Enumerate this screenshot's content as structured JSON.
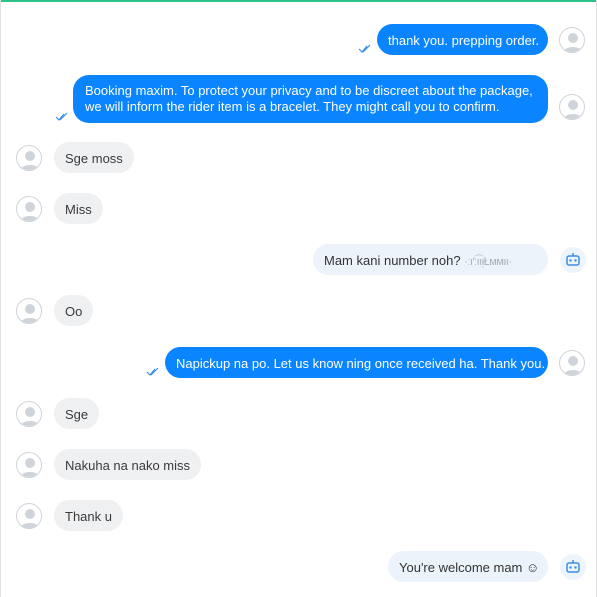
{
  "messages": [
    {
      "id": 1,
      "side": "right",
      "style": "blue",
      "text": "thank you. prepping order.",
      "status": "sent-check",
      "avatar": "user-avatar-icon"
    },
    {
      "id": 2,
      "side": "right",
      "style": "blue",
      "text": "Booking maxim. To protect your privacy and to be discreet about the package, we will inform the rider item is a bracelet. They might call you to confirm.",
      "status": "sent-check",
      "avatar": "user-avatar-icon"
    },
    {
      "id": 3,
      "side": "left",
      "style": "grey",
      "text": "Sge moss",
      "avatar": "user-avatar-icon"
    },
    {
      "id": 4,
      "side": "left",
      "style": "grey",
      "text": "Miss",
      "avatar": "user-avatar-icon"
    },
    {
      "id": 5,
      "side": "right",
      "style": "light",
      "text": "Mam kani number noh? ",
      "redacted": "·ːı′ːı͡ıᴉŁᴍᴍıı·",
      "avatar": "bot-icon"
    },
    {
      "id": 6,
      "side": "left",
      "style": "grey",
      "text": "Oo",
      "avatar": "user-avatar-icon"
    },
    {
      "id": 7,
      "side": "right",
      "style": "blue",
      "text": "Napickup na po. Let us know ning once received ha. Thank you.",
      "status": "sent-check",
      "avatar": "user-avatar-icon"
    },
    {
      "id": 8,
      "side": "left",
      "style": "grey",
      "text": "Sge",
      "avatar": "user-avatar-icon"
    },
    {
      "id": 9,
      "side": "left",
      "style": "grey",
      "text": "Nakuha na nako miss",
      "avatar": "user-avatar-icon"
    },
    {
      "id": 10,
      "side": "left",
      "style": "grey",
      "text": "Thank u",
      "avatar": "user-avatar-icon"
    },
    {
      "id": 11,
      "side": "right",
      "style": "light",
      "text": "You're welcome mam ☺",
      "avatar": "bot-icon"
    }
  ],
  "colors": {
    "sent_bubble": "#0a84ff",
    "received_bubble": "#eff0f2",
    "bot_bubble": "#edf3fb",
    "check_mark": "#3a8ee6",
    "bot_icon": "#3a8ee6",
    "top_accent": "#2ec28a"
  }
}
